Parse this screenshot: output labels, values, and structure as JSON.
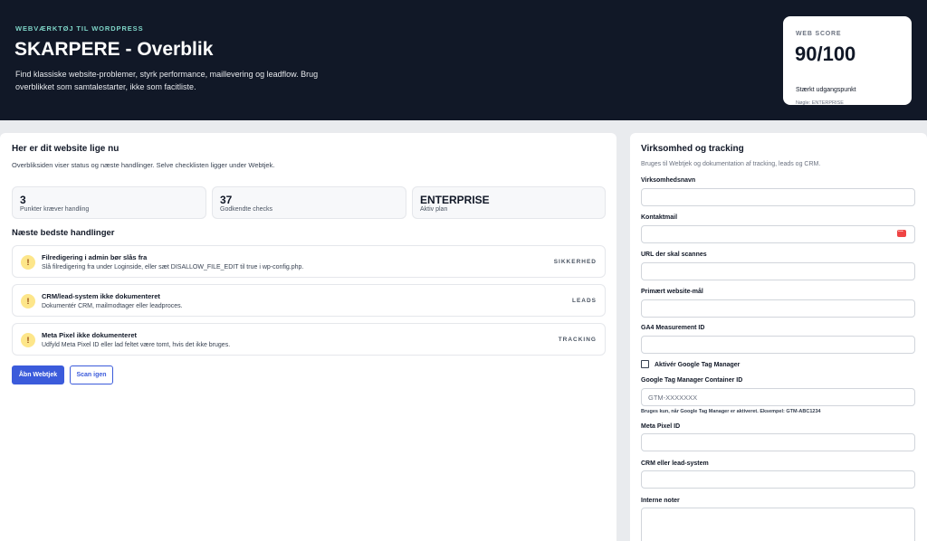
{
  "header": {
    "eyebrow": "WEBVÆRKTØJ TIL WORDPRESS",
    "title": "SKARPERE - Overblik",
    "description": "Find klassiske website-problemer, styrk performance, maillevering og leadflow. Brug overblikket som samtalestarter, ikke som facitliste."
  },
  "score": {
    "label": "WEB SCORE",
    "value": "90/100",
    "summary": "Stærkt udgangspunkt",
    "key": "Nøgle: ENTERPRISE"
  },
  "overview": {
    "title": "Her er dit website lige nu",
    "subtitle": "Overbliksiden viser status og næste handlinger. Selve checklisten ligger under Webtjek.",
    "stats": [
      {
        "value": "3",
        "label": "Punkter kræver handling"
      },
      {
        "value": "37",
        "label": "Godkendte checks"
      },
      {
        "value": "ENTERPRISE",
        "label": "Aktiv plan"
      }
    ],
    "actions_title": "Næste bedste handlinger",
    "actions": [
      {
        "icon": "!",
        "title": "Filredigering i admin bør slås fra",
        "desc": "Slå filredigering fra under Loginside, eller sæt DISALLOW_FILE_EDIT til true i wp-config.php.",
        "tag": "SIKKERHED"
      },
      {
        "icon": "!",
        "title": "CRM/lead-system ikke dokumenteret",
        "desc": "Dokumentér CRM, mailmodtager eller leadproces.",
        "tag": "LEADS"
      },
      {
        "icon": "!",
        "title": "Meta Pixel ikke dokumenteret",
        "desc": "Udfyld Meta Pixel ID eller lad feltet være tomt, hvis det ikke bruges.",
        "tag": "TRACKING"
      }
    ],
    "open_button": "Åbn Webtjek",
    "rescan_button": "Scan igen"
  },
  "form": {
    "title": "Virksomhed og tracking",
    "subtitle": "Bruges til Webtjek og dokumentation af tracking, leads og CRM.",
    "company_label": "Virksomhedsnavn",
    "company_value": "",
    "email_label": "Kontaktmail",
    "email_value": "",
    "url_label": "URL der skal scannes",
    "url_value": "",
    "goal_label": "Primært website-mål",
    "goal_value": "",
    "ga4_label": "GA4 Measurement ID",
    "ga4_value": "",
    "gtm_checkbox_label": "Aktivér Google Tag Manager",
    "gtm_checked": false,
    "gtm_label": "Google Tag Manager Container ID",
    "gtm_placeholder": "GTM-XXXXXXX",
    "gtm_hint": "Bruges kun, når Google Tag Manager er aktiveret. Eksempel: GTM-ABC1234",
    "pixel_label": "Meta Pixel ID",
    "pixel_value": "",
    "crm_label": "CRM eller lead-system",
    "crm_value": "",
    "notes_label": "Interne noter"
  },
  "colors": {
    "header_bg": "#111827",
    "accent": "#3b5bdb",
    "warning": "#fde68a",
    "eyebrow": "#7dd3c6"
  }
}
